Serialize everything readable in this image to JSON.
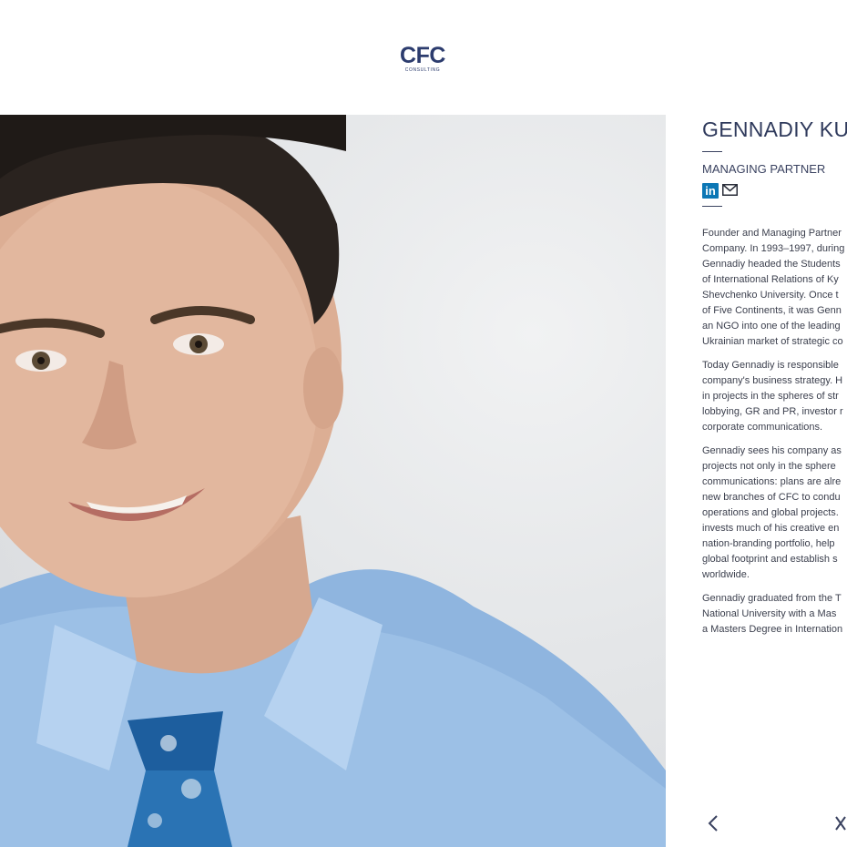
{
  "header": {
    "logo_mark": "CFC",
    "logo_sub": "CONSULTING"
  },
  "profile": {
    "name": "GENNADIY KUR",
    "role": "MANAGING PARTNER",
    "linkedin_label": "in",
    "bio": [
      [
        "Founder and Managing Partner",
        "Company. In 1993–1997, during",
        "Gennadiy headed the Students",
        "of International Relations of Ky",
        "Shevchenko University. Once t",
        "of Five Continents, it was Genn",
        "an NGO into one of the leading",
        "Ukrainian market of strategic co"
      ],
      [
        "Today Gennadiy is responsible",
        "company's business strategy. H",
        "in projects in the spheres of str",
        "lobbying, GR and PR, investor r",
        "corporate communications."
      ],
      [
        "Gennadiy sees his company as",
        "projects not only in the sphere",
        "communications: plans are alre",
        "new branches of CFC to condu",
        "operations and global projects.",
        "invests much of his creative en",
        "nation-branding portfolio, help",
        "global footprint and establish s",
        "worldwide."
      ],
      [
        "Gennadiy graduated from the T",
        "National University with a Mas",
        "a Masters Degree in Internation"
      ]
    ]
  },
  "nav": {
    "prev_icon": "chevron-left-icon",
    "next_icon": "close-icon"
  },
  "colors": {
    "brand": "#2c3c6e",
    "linkedin": "#0c77b5",
    "text": "#3b3f4d"
  }
}
